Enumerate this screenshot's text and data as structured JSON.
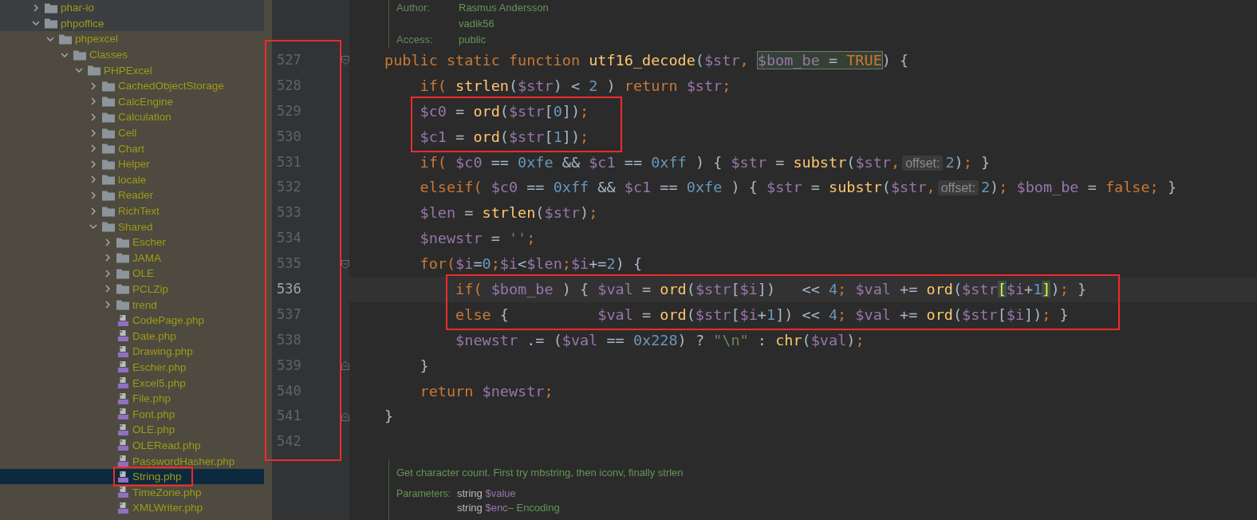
{
  "sidebar": {
    "tree": [
      {
        "name": "phar-io",
        "kind": "folder",
        "expanded": false,
        "selected": false,
        "scoped": false,
        "annotated": false
      },
      {
        "name": "phpoffice",
        "kind": "folder",
        "expanded": true,
        "selected": false,
        "scoped": false,
        "annotated": false,
        "children": [
          {
            "name": "phpexcel",
            "kind": "folder",
            "expanded": true,
            "selected": false,
            "scoped": true,
            "annotated": false,
            "children": [
              {
                "name": "Classes",
                "kind": "folder",
                "expanded": true,
                "selected": false,
                "scoped": true,
                "annotated": false,
                "children": [
                  {
                    "name": "PHPExcel",
                    "kind": "folder",
                    "expanded": true,
                    "selected": false,
                    "scoped": true,
                    "annotated": false,
                    "children": [
                      {
                        "name": "CachedObjectStorage",
                        "kind": "folder",
                        "expanded": false,
                        "selected": false,
                        "scoped": true,
                        "annotated": false
                      },
                      {
                        "name": "CalcEngine",
                        "kind": "folder",
                        "expanded": false,
                        "selected": false,
                        "scoped": true,
                        "annotated": false
                      },
                      {
                        "name": "Calculation",
                        "kind": "folder",
                        "expanded": false,
                        "selected": false,
                        "scoped": true,
                        "annotated": false
                      },
                      {
                        "name": "Cell",
                        "kind": "folder",
                        "expanded": false,
                        "selected": false,
                        "scoped": true,
                        "annotated": false
                      },
                      {
                        "name": "Chart",
                        "kind": "folder",
                        "expanded": false,
                        "selected": false,
                        "scoped": true,
                        "annotated": false
                      },
                      {
                        "name": "Helper",
                        "kind": "folder",
                        "expanded": false,
                        "selected": false,
                        "scoped": true,
                        "annotated": false
                      },
                      {
                        "name": "locale",
                        "kind": "folder",
                        "expanded": false,
                        "selected": false,
                        "scoped": true,
                        "annotated": false
                      },
                      {
                        "name": "Reader",
                        "kind": "folder",
                        "expanded": false,
                        "selected": false,
                        "scoped": true,
                        "annotated": false
                      },
                      {
                        "name": "RichText",
                        "kind": "folder",
                        "expanded": false,
                        "selected": false,
                        "scoped": true,
                        "annotated": false
                      },
                      {
                        "name": "Shared",
                        "kind": "folder",
                        "expanded": true,
                        "selected": false,
                        "scoped": true,
                        "annotated": false,
                        "children": [
                          {
                            "name": "Escher",
                            "kind": "folder",
                            "expanded": false,
                            "selected": false,
                            "scoped": true,
                            "annotated": false
                          },
                          {
                            "name": "JAMA",
                            "kind": "folder",
                            "expanded": false,
                            "selected": false,
                            "scoped": true,
                            "annotated": false
                          },
                          {
                            "name": "OLE",
                            "kind": "folder",
                            "expanded": false,
                            "selected": false,
                            "scoped": true,
                            "annotated": false
                          },
                          {
                            "name": "PCLZip",
                            "kind": "folder",
                            "expanded": false,
                            "selected": false,
                            "scoped": true,
                            "annotated": false
                          },
                          {
                            "name": "trend",
                            "kind": "folder",
                            "expanded": false,
                            "selected": false,
                            "scoped": true,
                            "annotated": false
                          },
                          {
                            "name": "CodePage.php",
                            "kind": "file",
                            "selected": false,
                            "scoped": true,
                            "annotated": false
                          },
                          {
                            "name": "Date.php",
                            "kind": "file",
                            "selected": false,
                            "scoped": true,
                            "annotated": false
                          },
                          {
                            "name": "Drawing.php",
                            "kind": "file",
                            "selected": false,
                            "scoped": true,
                            "annotated": false
                          },
                          {
                            "name": "Escher.php",
                            "kind": "file",
                            "selected": false,
                            "scoped": true,
                            "annotated": false
                          },
                          {
                            "name": "Excel5.php",
                            "kind": "file",
                            "selected": false,
                            "scoped": true,
                            "annotated": false
                          },
                          {
                            "name": "File.php",
                            "kind": "file",
                            "selected": false,
                            "scoped": true,
                            "annotated": false
                          },
                          {
                            "name": "Font.php",
                            "kind": "file",
                            "selected": false,
                            "scoped": true,
                            "annotated": false
                          },
                          {
                            "name": "OLE.php",
                            "kind": "file",
                            "selected": false,
                            "scoped": true,
                            "annotated": false
                          },
                          {
                            "name": "OLERead.php",
                            "kind": "file",
                            "selected": false,
                            "scoped": true,
                            "annotated": false
                          },
                          {
                            "name": "PasswordHasher.php",
                            "kind": "file",
                            "selected": false,
                            "scoped": true,
                            "annotated": false
                          },
                          {
                            "name": "String.php",
                            "kind": "file",
                            "selected": true,
                            "scoped": true,
                            "annotated": true
                          },
                          {
                            "name": "TimeZone.php",
                            "kind": "file",
                            "selected": false,
                            "scoped": true,
                            "annotated": false
                          },
                          {
                            "name": "XMLWriter.php",
                            "kind": "file",
                            "selected": false,
                            "scoped": true,
                            "annotated": false
                          }
                        ]
                      }
                    ]
                  }
                ]
              }
            ]
          }
        ]
      }
    ]
  },
  "editor": {
    "doc_top": {
      "fields": [
        {
          "label": "Author:",
          "values": [
            "Rasmus Andersson",
            "vadik56"
          ]
        },
        {
          "label": "Access:",
          "values": [
            "public"
          ]
        }
      ]
    },
    "gutter": {
      "annotated": true
    },
    "blocks": [
      {
        "annotated": false,
        "lines": [
          {
            "number": "527",
            "current": false,
            "kind": "fold-start",
            "tokens": [
              {
                "kind": "kw",
                "text": "public static function "
              },
              {
                "kind": "fn",
                "text": "utf16_decode"
              },
              {
                "kind": "plain",
                "text": "("
              },
              {
                "kind": "var",
                "text": "$str"
              },
              {
                "kind": "kw",
                "text": ", "
              },
              {
                "kind": "highlight",
                "tokens": [
                  {
                    "kind": "var",
                    "text": "$bom_be"
                  },
                  {
                    "kind": "plain",
                    "text": " = "
                  },
                  {
                    "kind": "kw",
                    "text": "TRUE"
                  }
                ]
              },
              {
                "kind": "plain",
                "text": ") {"
              }
            ]
          },
          {
            "number": "528",
            "current": false,
            "kind": "code",
            "tokens": [
              {
                "kind": "kw",
                "text": "    if( "
              },
              {
                "kind": "fn",
                "text": "strlen"
              },
              {
                "kind": "plain",
                "text": "("
              },
              {
                "kind": "var",
                "text": "$str"
              },
              {
                "kind": "plain",
                "text": ") < "
              },
              {
                "kind": "num",
                "text": "2"
              },
              {
                "kind": "plain",
                "text": " ) "
              },
              {
                "kind": "kw",
                "text": "return "
              },
              {
                "kind": "var",
                "text": "$str"
              },
              {
                "kind": "kw",
                "text": ";"
              }
            ]
          }
        ]
      },
      {
        "annotated": true,
        "lines": [
          {
            "number": "529",
            "current": false,
            "kind": "code",
            "tokens": [
              {
                "kind": "var",
                "text": "    $c0"
              },
              {
                "kind": "plain",
                "text": " = "
              },
              {
                "kind": "fn",
                "text": "ord"
              },
              {
                "kind": "plain",
                "text": "("
              },
              {
                "kind": "var",
                "text": "$str"
              },
              {
                "kind": "plain",
                "text": "["
              },
              {
                "kind": "num",
                "text": "0"
              },
              {
                "kind": "plain",
                "text": "])"
              },
              {
                "kind": "kw",
                "text": ";"
              }
            ]
          },
          {
            "number": "530",
            "current": false,
            "kind": "code",
            "tokens": [
              {
                "kind": "var",
                "text": "    $c1"
              },
              {
                "kind": "plain",
                "text": " = "
              },
              {
                "kind": "fn",
                "text": "ord"
              },
              {
                "kind": "plain",
                "text": "("
              },
              {
                "kind": "var",
                "text": "$str"
              },
              {
                "kind": "plain",
                "text": "["
              },
              {
                "kind": "num",
                "text": "1"
              },
              {
                "kind": "plain",
                "text": "])"
              },
              {
                "kind": "kw",
                "text": ";"
              }
            ]
          }
        ]
      },
      {
        "annotated": false,
        "lines": [
          {
            "number": "531",
            "current": false,
            "kind": "code",
            "tokens": [
              {
                "kind": "kw",
                "text": "    if( "
              },
              {
                "kind": "var",
                "text": "$c0"
              },
              {
                "kind": "plain",
                "text": " == "
              },
              {
                "kind": "num",
                "text": "0xfe"
              },
              {
                "kind": "plain",
                "text": " && "
              },
              {
                "kind": "var",
                "text": "$c1"
              },
              {
                "kind": "plain",
                "text": " == "
              },
              {
                "kind": "num",
                "text": "0xff"
              },
              {
                "kind": "plain",
                "text": " ) { "
              },
              {
                "kind": "var",
                "text": "$str"
              },
              {
                "kind": "plain",
                "text": " = "
              },
              {
                "kind": "fn",
                "text": "substr"
              },
              {
                "kind": "plain",
                "text": "("
              },
              {
                "kind": "var",
                "text": "$str"
              },
              {
                "kind": "kw",
                "text": ","
              },
              {
                "kind": "hint",
                "text": "offset:"
              },
              {
                "kind": "num",
                "text": "2"
              },
              {
                "kind": "plain",
                "text": ")"
              },
              {
                "kind": "kw",
                "text": ";"
              },
              {
                "kind": "plain",
                "text": " }"
              }
            ]
          },
          {
            "number": "532",
            "current": false,
            "kind": "code",
            "tokens": [
              {
                "kind": "kw",
                "text": "    elseif( "
              },
              {
                "kind": "var",
                "text": "$c0"
              },
              {
                "kind": "plain",
                "text": " == "
              },
              {
                "kind": "num",
                "text": "0xff"
              },
              {
                "kind": "plain",
                "text": " && "
              },
              {
                "kind": "var",
                "text": "$c1"
              },
              {
                "kind": "plain",
                "text": " == "
              },
              {
                "kind": "num",
                "text": "0xfe"
              },
              {
                "kind": "plain",
                "text": " ) { "
              },
              {
                "kind": "var",
                "text": "$str"
              },
              {
                "kind": "plain",
                "text": " = "
              },
              {
                "kind": "fn",
                "text": "substr"
              },
              {
                "kind": "plain",
                "text": "("
              },
              {
                "kind": "var",
                "text": "$str"
              },
              {
                "kind": "kw",
                "text": ","
              },
              {
                "kind": "hint",
                "text": "offset:"
              },
              {
                "kind": "num",
                "text": "2"
              },
              {
                "kind": "plain",
                "text": ")"
              },
              {
                "kind": "kw",
                "text": ";"
              },
              {
                "kind": "var",
                "text": " $bom_be"
              },
              {
                "kind": "plain",
                "text": " = "
              },
              {
                "kind": "kw",
                "text": "false;"
              },
              {
                "kind": "plain",
                "text": " }"
              }
            ]
          },
          {
            "number": "533",
            "current": false,
            "kind": "code",
            "tokens": [
              {
                "kind": "var",
                "text": "    $len"
              },
              {
                "kind": "plain",
                "text": " = "
              },
              {
                "kind": "fn",
                "text": "strlen"
              },
              {
                "kind": "plain",
                "text": "("
              },
              {
                "kind": "var",
                "text": "$str"
              },
              {
                "kind": "plain",
                "text": ")"
              },
              {
                "kind": "kw",
                "text": ";"
              }
            ]
          },
          {
            "number": "534",
            "current": false,
            "kind": "code",
            "tokens": [
              {
                "kind": "var",
                "text": "    $newstr"
              },
              {
                "kind": "plain",
                "text": " = "
              },
              {
                "kind": "str",
                "text": "''"
              },
              {
                "kind": "kw",
                "text": ";"
              }
            ]
          },
          {
            "number": "535",
            "current": false,
            "kind": "fold-start",
            "tokens": [
              {
                "kind": "kw",
                "text": "    for("
              },
              {
                "kind": "var",
                "text": "$i"
              },
              {
                "kind": "plain",
                "text": "="
              },
              {
                "kind": "num",
                "text": "0"
              },
              {
                "kind": "kw",
                "text": ";"
              },
              {
                "kind": "var",
                "text": "$i"
              },
              {
                "kind": "plain",
                "text": "<"
              },
              {
                "kind": "var",
                "text": "$len"
              },
              {
                "kind": "kw",
                "text": ";"
              },
              {
                "kind": "var",
                "text": "$i"
              },
              {
                "kind": "plain",
                "text": "+="
              },
              {
                "kind": "num",
                "text": "2"
              },
              {
                "kind": "plain",
                "text": ") {"
              }
            ]
          }
        ]
      },
      {
        "annotated": true,
        "lines": [
          {
            "number": "536",
            "current": true,
            "kind": "code",
            "tokens": [
              {
                "kind": "kw",
                "text": "        if( "
              },
              {
                "kind": "var",
                "text": "$bom_be"
              },
              {
                "kind": "plain",
                "text": " ) { "
              },
              {
                "kind": "var",
                "text": "$val"
              },
              {
                "kind": "plain",
                "text": " = "
              },
              {
                "kind": "fn",
                "text": "ord"
              },
              {
                "kind": "plain",
                "text": "("
              },
              {
                "kind": "var",
                "text": "$str"
              },
              {
                "kind": "plain",
                "text": "["
              },
              {
                "kind": "var",
                "text": "$i"
              },
              {
                "kind": "plain",
                "text": "])   << "
              },
              {
                "kind": "num",
                "text": "4"
              },
              {
                "kind": "kw",
                "text": ";"
              },
              {
                "kind": "var",
                "text": " $val"
              },
              {
                "kind": "plain",
                "text": " += "
              },
              {
                "kind": "fn",
                "text": "ord"
              },
              {
                "kind": "plain",
                "text": "("
              },
              {
                "kind": "var",
                "text": "$str"
              },
              {
                "kind": "match",
                "text": "["
              },
              {
                "kind": "var",
                "text": "$i"
              },
              {
                "kind": "plain",
                "text": "+"
              },
              {
                "kind": "num",
                "text": "1"
              },
              {
                "kind": "match",
                "text": "]"
              },
              {
                "kind": "plain",
                "text": ")"
              },
              {
                "kind": "kw",
                "text": ";"
              },
              {
                "kind": "plain",
                "text": " }"
              }
            ]
          },
          {
            "number": "537",
            "current": false,
            "kind": "code",
            "tokens": [
              {
                "kind": "kw",
                "text": "        else"
              },
              {
                "kind": "plain",
                "text": " {          "
              },
              {
                "kind": "var",
                "text": "$val"
              },
              {
                "kind": "plain",
                "text": " = "
              },
              {
                "kind": "fn",
                "text": "ord"
              },
              {
                "kind": "plain",
                "text": "("
              },
              {
                "kind": "var",
                "text": "$str"
              },
              {
                "kind": "plain",
                "text": "["
              },
              {
                "kind": "var",
                "text": "$i"
              },
              {
                "kind": "plain",
                "text": "+"
              },
              {
                "kind": "num",
                "text": "1"
              },
              {
                "kind": "plain",
                "text": "]) << "
              },
              {
                "kind": "num",
                "text": "4"
              },
              {
                "kind": "kw",
                "text": ";"
              },
              {
                "kind": "var",
                "text": " $val"
              },
              {
                "kind": "plain",
                "text": " += "
              },
              {
                "kind": "fn",
                "text": "ord"
              },
              {
                "kind": "plain",
                "text": "("
              },
              {
                "kind": "var",
                "text": "$str"
              },
              {
                "kind": "plain",
                "text": "["
              },
              {
                "kind": "var",
                "text": "$i"
              },
              {
                "kind": "plain",
                "text": "])"
              },
              {
                "kind": "kw",
                "text": ";"
              },
              {
                "kind": "plain",
                "text": " }"
              }
            ]
          }
        ]
      },
      {
        "annotated": false,
        "lines": [
          {
            "number": "538",
            "current": false,
            "kind": "code",
            "tokens": [
              {
                "kind": "var",
                "text": "        $newstr"
              },
              {
                "kind": "plain",
                "text": " .= ("
              },
              {
                "kind": "var",
                "text": "$val"
              },
              {
                "kind": "plain",
                "text": " == "
              },
              {
                "kind": "num",
                "text": "0x228"
              },
              {
                "kind": "plain",
                "text": ") ? "
              },
              {
                "kind": "str",
                "text": "\"\\n\""
              },
              {
                "kind": "plain",
                "text": " : "
              },
              {
                "kind": "fn",
                "text": "chr"
              },
              {
                "kind": "plain",
                "text": "("
              },
              {
                "kind": "var",
                "text": "$val"
              },
              {
                "kind": "plain",
                "text": ")"
              },
              {
                "kind": "kw",
                "text": ";"
              }
            ]
          },
          {
            "number": "539",
            "current": false,
            "kind": "fold-end",
            "tokens": [
              {
                "kind": "plain",
                "text": "    }"
              }
            ]
          },
          {
            "number": "540",
            "current": false,
            "kind": "code",
            "tokens": [
              {
                "kind": "kw",
                "text": "    return "
              },
              {
                "kind": "var",
                "text": "$newstr"
              },
              {
                "kind": "kw",
                "text": ";"
              }
            ]
          },
          {
            "number": "541",
            "current": false,
            "kind": "fold-end",
            "tokens": [
              {
                "kind": "plain",
                "text": "}"
              }
            ]
          },
          {
            "number": "542",
            "current": false,
            "kind": "code"
          }
        ]
      }
    ],
    "doc_bottom": {
      "summary": "Get character count. First try mbstring, then iconv, finally strlen",
      "label": "Parameters:",
      "params": [
        {
          "type": "string",
          "name": "$value"
        },
        {
          "type": "string",
          "name": "$enc",
          "description": "– Encoding"
        }
      ]
    }
  }
}
